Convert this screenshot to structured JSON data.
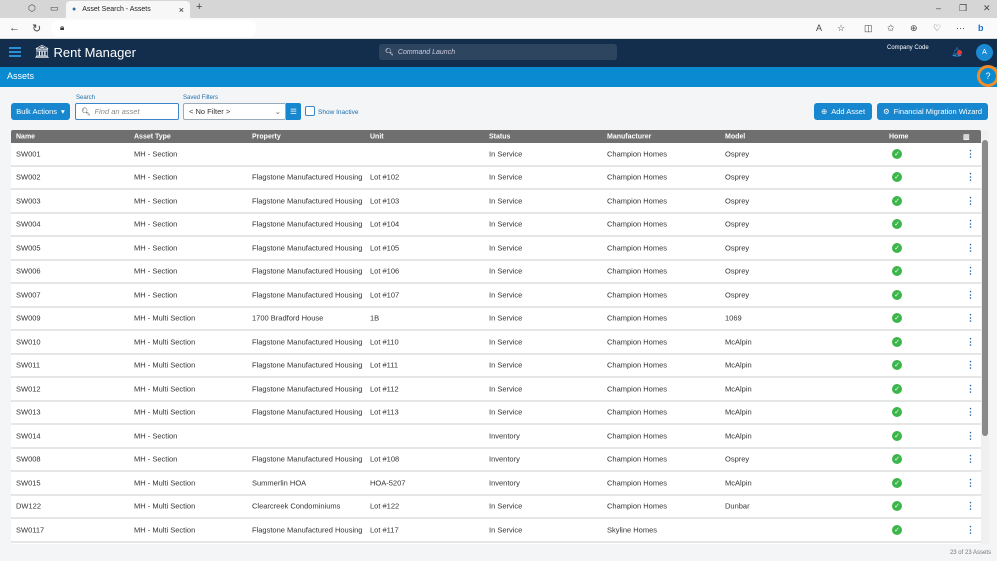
{
  "browser": {
    "tab_title": "Asset Search - Assets"
  },
  "app": {
    "logo": "Rent Manager",
    "command_placeholder": "Command Launch",
    "company_code": "Company Code",
    "avatar": "A",
    "page_title": "Assets"
  },
  "toolbar": {
    "bulk_actions": "Bulk Actions",
    "search_label": "Search",
    "search_placeholder": "Find an asset",
    "saved_filters_label": "Saved Filters",
    "saved_filter_value": "< No Filter >",
    "show_inactive": "Show Inactive",
    "add_asset": "Add Asset",
    "financial_wizard": "Financial Migration Wizard"
  },
  "table": {
    "columns": [
      "Name",
      "Asset Type",
      "Property",
      "Unit",
      "Status",
      "Manufacturer",
      "Model",
      "Home"
    ],
    "rows": [
      [
        "SW001",
        "MH - Section",
        "",
        "",
        "In Service",
        "Champion Homes",
        "Osprey"
      ],
      [
        "SW002",
        "MH - Section",
        "Flagstone Manufactured Housing",
        "Lot #102",
        "In Service",
        "Champion Homes",
        "Osprey"
      ],
      [
        "SW003",
        "MH - Section",
        "Flagstone Manufactured Housing",
        "Lot #103",
        "In Service",
        "Champion Homes",
        "Osprey"
      ],
      [
        "SW004",
        "MH - Section",
        "Flagstone Manufactured Housing",
        "Lot #104",
        "In Service",
        "Champion Homes",
        "Osprey"
      ],
      [
        "SW005",
        "MH - Section",
        "Flagstone Manufactured Housing",
        "Lot #105",
        "In Service",
        "Champion Homes",
        "Osprey"
      ],
      [
        "SW006",
        "MH - Section",
        "Flagstone Manufactured Housing",
        "Lot #106",
        "In Service",
        "Champion Homes",
        "Osprey"
      ],
      [
        "SW007",
        "MH - Section",
        "Flagstone Manufactured Housing",
        "Lot #107",
        "In Service",
        "Champion Homes",
        "Osprey"
      ],
      [
        "SW009",
        "MH - Multi Section",
        "1700 Bradford House",
        "1B",
        "In Service",
        "Champion Homes",
        "1069"
      ],
      [
        "SW010",
        "MH - Multi Section",
        "Flagstone Manufactured Housing",
        "Lot #110",
        "In Service",
        "Champion Homes",
        "McAlpin"
      ],
      [
        "SW011",
        "MH - Multi Section",
        "Flagstone Manufactured Housing",
        "Lot #111",
        "In Service",
        "Champion Homes",
        "McAlpin"
      ],
      [
        "SW012",
        "MH - Multi Section",
        "Flagstone Manufactured Housing",
        "Lot #112",
        "In Service",
        "Champion Homes",
        "McAlpin"
      ],
      [
        "SW013",
        "MH - Multi Section",
        "Flagstone Manufactured Housing",
        "Lot #113",
        "In Service",
        "Champion Homes",
        "McAlpin"
      ],
      [
        "SW014",
        "MH - Section",
        "",
        "",
        "Inventory",
        "Champion Homes",
        "McAlpin"
      ],
      [
        "SW008",
        "MH - Section",
        "Flagstone Manufactured Housing",
        "Lot #108",
        "Inventory",
        "Champion Homes",
        "Osprey"
      ],
      [
        "SW015",
        "MH - Multi Section",
        "Summerlin HOA",
        "HOA-5207",
        "Inventory",
        "Champion Homes",
        "McAlpin"
      ],
      [
        "DW122",
        "MH - Multi Section",
        "Clearcreek Condominiums",
        "Lot #122",
        "In Service",
        "Champion Homes",
        "Dunbar"
      ],
      [
        "SW0117",
        "MH - Multi Section",
        "Flagstone Manufactured Housing",
        "Lot #117",
        "In Service",
        "Skyline Homes",
        ""
      ]
    ],
    "footer": "23 of 23 Assets"
  },
  "colors": {
    "header": "#132e4c",
    "accent": "#0a8ad0",
    "home_check": "#3cb54a",
    "highlight": "#f28c28"
  }
}
